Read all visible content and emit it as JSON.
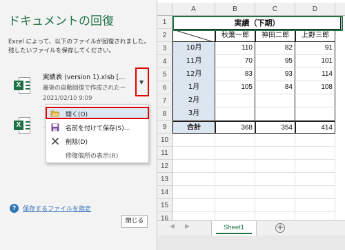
{
  "recovery": {
    "title": "ドキュメントの回復",
    "desc": "Excel によって、以下のファイルが回復されました。残したいファイルを保存してください。",
    "files": [
      {
        "icon": "excel-file-icon",
        "name": "実績表 (version 1).xlsb  [...",
        "sub": "最後の自動回復で作成されたー",
        "date": "2021/02/10 9:09"
      },
      {
        "icon": "excel-file-icon",
        "name": "",
        "sub": "ー",
        "date": ""
      }
    ],
    "dropdown_glyph": "▼",
    "menu": {
      "open": "開く(O)",
      "save_as": "名前を付けて保存(S)...",
      "delete": "削除(D)",
      "show_repairs": "修復個所の表示(R)"
    },
    "help_link": "保存するファイルを指定",
    "close": "閉じる"
  },
  "sheet": {
    "columns": [
      "A",
      "B",
      "C",
      "D"
    ],
    "rows": [
      "1",
      "2",
      "3",
      "4",
      "5",
      "6",
      "7",
      "8",
      "9",
      "10",
      "11",
      "12",
      "13",
      "14",
      "15",
      "16"
    ],
    "title": "実績（下期）",
    "names": [
      "秋葉一郎",
      "神田二郎",
      "上野三郎"
    ],
    "data": [
      {
        "month": "10月",
        "values": [
          "110",
          "82",
          "91"
        ]
      },
      {
        "month": "11月",
        "values": [
          "70",
          "95",
          "101"
        ]
      },
      {
        "month": "12月",
        "values": [
          "83",
          "93",
          "114"
        ]
      },
      {
        "month": "1月",
        "values": [
          "105",
          "84",
          "108"
        ]
      },
      {
        "month": "2月",
        "values": [
          "",
          "",
          ""
        ]
      },
      {
        "month": "3月",
        "values": [
          "",
          "",
          ""
        ]
      }
    ],
    "total": {
      "label": "合計",
      "values": [
        "368",
        "354",
        "414"
      ]
    },
    "tab": "Sheet1",
    "add_sheet": "+",
    "nav_prev": "◀",
    "nav_next": "▶"
  },
  "colors": {
    "excel_green": "#217346",
    "highlight_red": "#e00000",
    "month_fill": "#dce6f1"
  }
}
